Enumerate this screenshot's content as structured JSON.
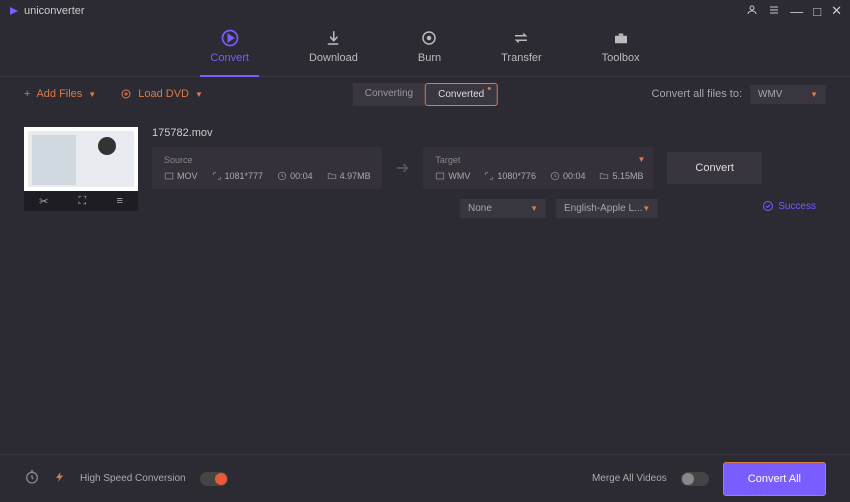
{
  "app": {
    "title": "uniconverter"
  },
  "nav": {
    "convert": "Convert",
    "download": "Download",
    "burn": "Burn",
    "transfer": "Transfer",
    "toolbox": "Toolbox"
  },
  "toolbar": {
    "add_files": "Add Files",
    "load_dvd": "Load DVD",
    "converting": "Converting",
    "converted": "Converted",
    "convert_all_label": "Convert all files to:",
    "convert_all_format": "WMV"
  },
  "file": {
    "name": "175782.mov",
    "source": {
      "label": "Source",
      "format": "MOV",
      "resolution": "1081*777",
      "duration": "00:04",
      "size": "4.97MB"
    },
    "target": {
      "label": "Target",
      "format": "WMV",
      "resolution": "1080*776",
      "duration": "00:04",
      "size": "5.15MB"
    },
    "convert_btn": "Convert",
    "subtitle": "None",
    "audio": "English-Apple L...",
    "status": "Success"
  },
  "footer": {
    "high_speed": "High Speed Conversion",
    "merge": "Merge All Videos",
    "convert_all": "Convert All"
  }
}
